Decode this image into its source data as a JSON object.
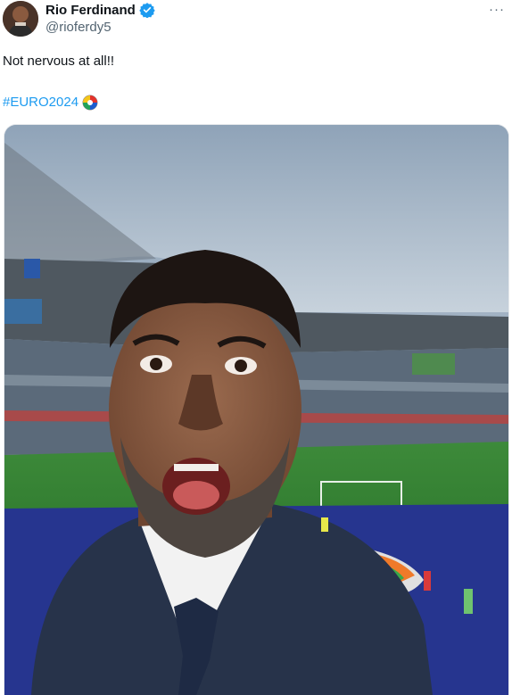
{
  "author": {
    "display_name": "Rio Ferdinand",
    "handle": "@rioferdy5",
    "verified": true
  },
  "tweet": {
    "text": "Not nervous at all!!",
    "hashtag": "#EURO2024"
  },
  "icons": {
    "verified": "verified-badge-icon",
    "more": "more-options-icon",
    "ball": "euro-ball-emoji-icon"
  },
  "colors": {
    "link": "#1d9bf0",
    "secondary_text": "#536471",
    "verified": "#1d9bf0"
  },
  "more_glyph": "···"
}
